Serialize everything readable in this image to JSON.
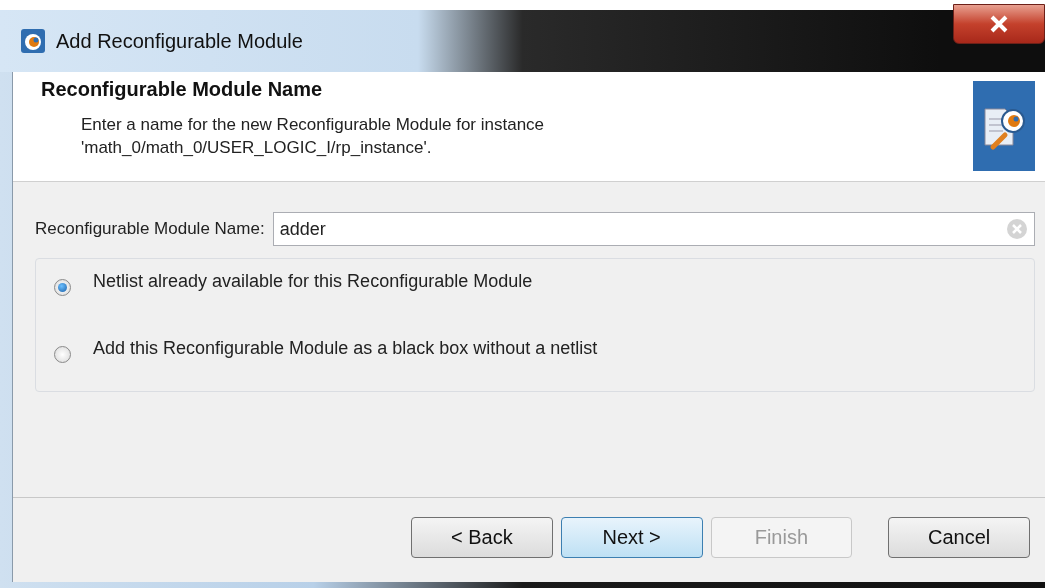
{
  "window": {
    "title": "Add Reconfigurable Module"
  },
  "header": {
    "title": "Reconfigurable Module Name",
    "description": "Enter a name for the new Reconfigurable Module for instance 'math_0/math_0/USER_LOGIC_I/rp_instance'."
  },
  "name_field": {
    "label": "Reconfigurable Module Name:",
    "value": "adder"
  },
  "options": [
    {
      "label": "Netlist already available for this Reconfigurable Module",
      "selected": true
    },
    {
      "label": "Add this Reconfigurable Module as a black box without a netlist",
      "selected": false
    }
  ],
  "buttons": [
    {
      "label": "< Back",
      "focused": false,
      "disabled": false
    },
    {
      "label": "Next >",
      "focused": true,
      "disabled": false
    },
    {
      "label": "Finish",
      "focused": false,
      "disabled": true
    },
    {
      "label": "Cancel",
      "focused": false,
      "disabled": false
    }
  ]
}
